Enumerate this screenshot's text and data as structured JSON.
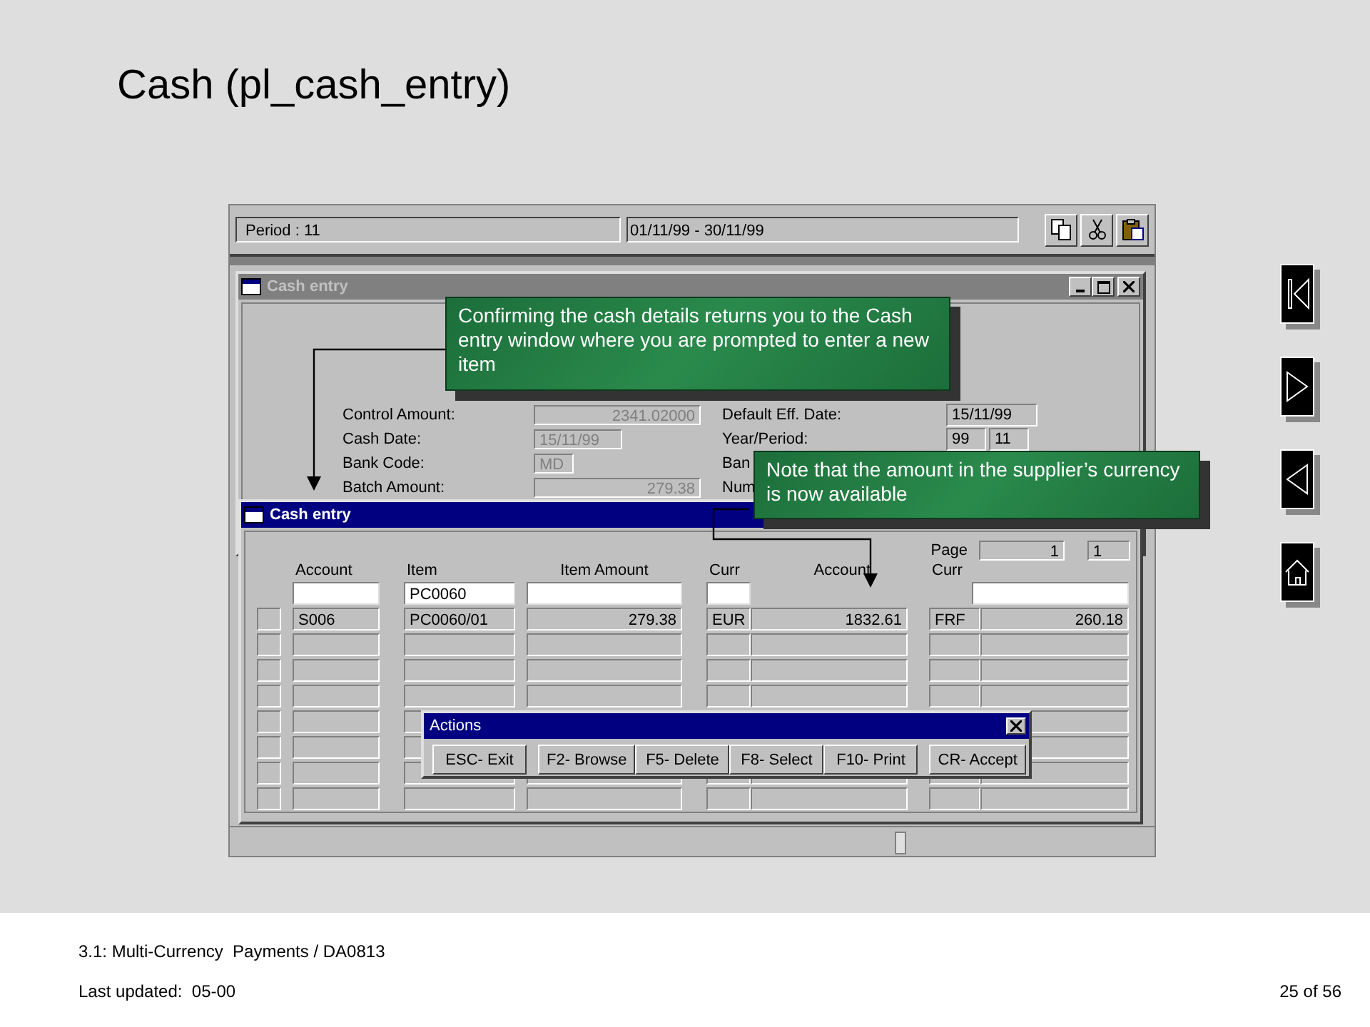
{
  "title": "Cash (pl_cash_entry)",
  "toolbar": {
    "period": "Period : 11",
    "date_range": "01/11/99 - 30/11/99"
  },
  "back_window": {
    "title": "Cash entry",
    "active": false,
    "left_fields": [
      {
        "label": "Control Amount:",
        "value": "2341.02000"
      },
      {
        "label": "Cash Date:",
        "value": "15/11/99"
      },
      {
        "label": "Bank Code:",
        "value": "MD"
      },
      {
        "label": "Batch Amount:",
        "value": "279.38"
      }
    ],
    "right_fields": [
      {
        "label": "Default Eff. Date:",
        "values": [
          "15/11/99"
        ]
      },
      {
        "label": "Year/Period:",
        "values": [
          "99",
          "11"
        ]
      },
      {
        "label": "Ban"
      },
      {
        "label": "Num"
      }
    ]
  },
  "front_window": {
    "title": "Cash entry",
    "active": true,
    "page": {
      "label": "Page",
      "current": "1",
      "total": "1"
    },
    "columns": [
      {
        "label": "Account",
        "filter_field": true
      },
      {
        "label": "Item",
        "filter_field": true,
        "filter_value": "PC0060"
      },
      {
        "label": "Item Amount",
        "filter_field": true
      },
      {
        "label": "Curr",
        "filter_field": true
      },
      {
        "label": "Account",
        "filter_field": false
      },
      {
        "label": "Curr",
        "filter_field": true
      }
    ],
    "rows": [
      [
        "S006",
        "PC0060/01",
        "279.38",
        "EUR",
        "1832.61",
        "FRF",
        "260.18"
      ]
    ]
  },
  "actions_dialog": {
    "title": "Actions",
    "buttons": [
      "ESC- Exit",
      "F2- Browse",
      "F5- Delete",
      "F8- Select",
      "F10- Print",
      "CR- Accept"
    ]
  },
  "callouts": [
    "Confirming the cash details returns you to the Cash entry window where you are prompted to enter a new item",
    "Note that the amount in the supplier’s currency is now available"
  ],
  "footer": {
    "course": "3.1: Multi-Currency  Payments / DA0813",
    "updated": "Last updated:  05-00",
    "page": "25 of 56"
  }
}
